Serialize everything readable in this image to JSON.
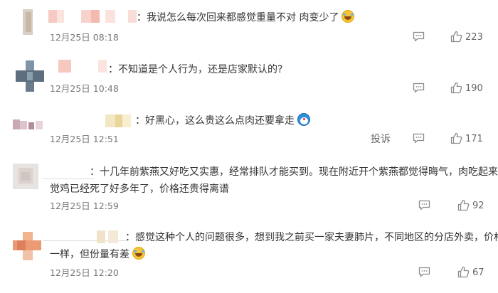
{
  "colors": {
    "text": "#333333",
    "meta": "#777777",
    "icon": "#8a8a8a"
  },
  "comments": [
    {
      "text_lines": [
        "我说怎么每次回来都感觉重量不对 肉变少了"
      ],
      "emoji": "laugh-cry-emoji",
      "time": "12月25日 08:18",
      "likes": "223"
    },
    {
      "text_lines": [
        "不知道是个人行为，还是店家默认的?"
      ],
      "emoji": "",
      "time": "12月25日 10:48",
      "likes": "190"
    },
    {
      "text_lines": [
        "好黑心，这么贵这么点肉还要拿走"
      ],
      "emoji": "doraemon-emoji",
      "time": "12月25日 12:51",
      "likes": "171",
      "report_label": "投诉"
    },
    {
      "text_lines": [
        "十几年前紫燕又好吃又实惠，经常排队才能买到。现在附近开个紫燕都觉得晦气，肉吃起来感",
        "觉鸡已经死了好多年了，价格还贵得离谱"
      ],
      "emoji": "",
      "time": "12月25日 12:59",
      "likes": "92"
    },
    {
      "text_lines": [
        "感觉这种个人的问题很多，想到我之前买一家夫妻肺片，不同地区的分店外卖，价格",
        "一样，但份量有差"
      ],
      "emoji": "laugh-cry-emoji",
      "time": "12月25日 12:20",
      "likes": "67"
    }
  ],
  "colon": "："
}
